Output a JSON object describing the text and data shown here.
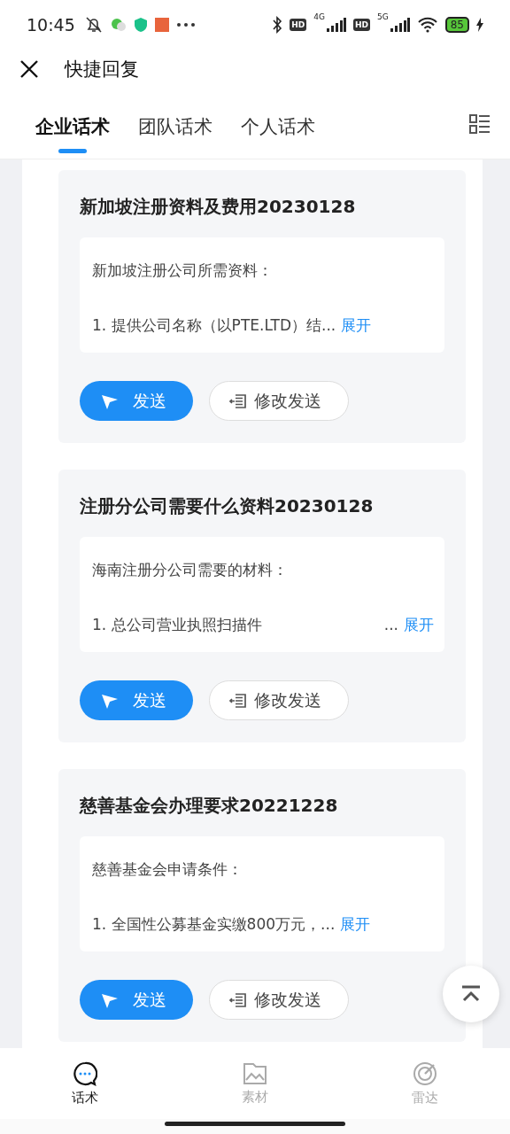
{
  "status_bar": {
    "time": "10:45",
    "hd_badges": [
      "HD",
      "HD"
    ],
    "networks": [
      "4G",
      "5G"
    ],
    "battery": "85"
  },
  "header": {
    "title": "快捷回复"
  },
  "tabs": [
    {
      "label": "企业话术",
      "selected": true
    },
    {
      "label": "团队话术",
      "selected": false
    },
    {
      "label": "个人话术",
      "selected": false
    }
  ],
  "cards": [
    {
      "title": "新加坡注册资料及费用20230128",
      "line_1": "新加坡注册公司所需资料：",
      "line_2": "1. 提供公司名称（以PTE.LTD）结...",
      "more": "展开",
      "send": "发送",
      "edit_send": "修改发送"
    },
    {
      "title": "注册分公司需要什么资料20230128",
      "line_1": "海南注册分公司需要的材料：",
      "line_2": "1. 总公司营业执照扫描件",
      "ellipsis": "...",
      "more": "展开",
      "send": "发送",
      "edit_send": "修改发送"
    },
    {
      "title": "慈善基金会办理要求20221228",
      "line_1": "慈善基金会申请条件：",
      "line_2": "1. 全国性公募基金实缴800万元，...",
      "more": "展开",
      "send": "发送",
      "edit_send": "修改发送"
    }
  ],
  "bottom_nav": [
    {
      "kind": "chat",
      "label": "话术",
      "selected": true
    },
    {
      "kind": "gallery",
      "label": "素材",
      "selected": false
    },
    {
      "kind": "radar",
      "label": "雷达",
      "selected": false
    }
  ]
}
